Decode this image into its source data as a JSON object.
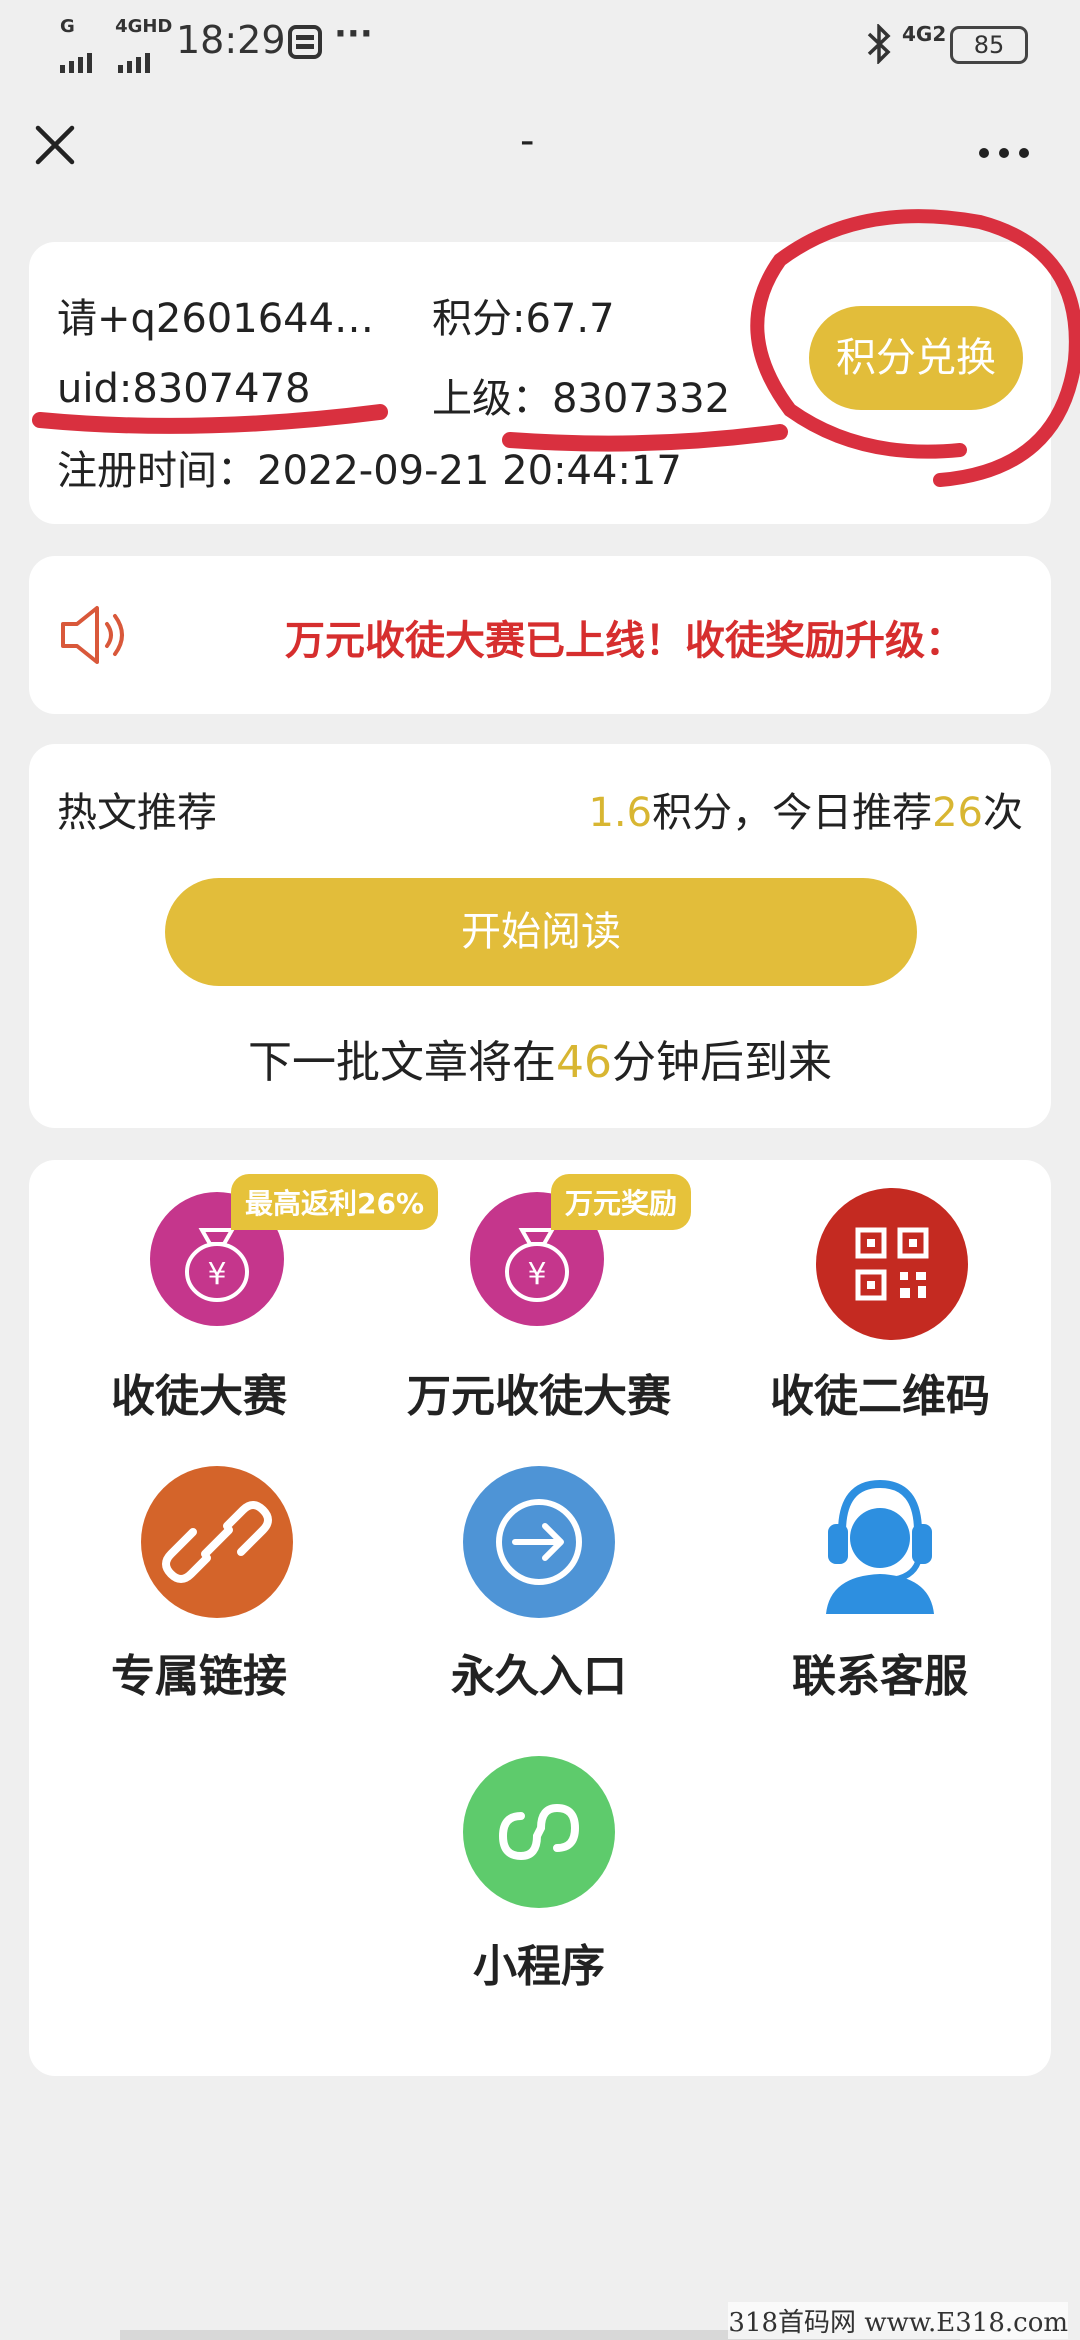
{
  "status_bar": {
    "signal_labels": [
      "G",
      "4GHD"
    ],
    "time": "18:29",
    "more": "···",
    "net": "4G2",
    "battery": "85"
  },
  "nav": {
    "title": "-",
    "more": "···"
  },
  "user": {
    "name": "请+q2601644…",
    "points": "积分:67.7",
    "uid": "uid:8307478",
    "superior": "上级：8307332",
    "register_time": "注册时间：2022-09-21 20:44:17",
    "exchange_button": "积分兑换"
  },
  "notice": {
    "text": "万元收徒大赛已上线！收徒奖励升级：",
    "icon": "speaker-icon"
  },
  "reading": {
    "title": "热文推荐",
    "points_value": "1.6",
    "points_text": "积分，今日推荐",
    "count": "26",
    "count_suffix": "次",
    "start_button": "开始阅读",
    "next_prefix": "下一批文章将在",
    "next_minutes": "46",
    "next_suffix": "分钟后到来"
  },
  "grid": [
    {
      "label": "收徒大赛",
      "badge": "最高返利26%",
      "icon": "money-bag-icon",
      "color": "#c5368c"
    },
    {
      "label": "万元收徒大赛",
      "badge": "万元奖励",
      "icon": "money-bag-icon",
      "color": "#c5368c"
    },
    {
      "label": "收徒二维码",
      "icon": "qr-code-icon",
      "color": "#c42a21"
    },
    {
      "label": "专属链接",
      "icon": "link-icon",
      "color": "#d4642a"
    },
    {
      "label": "永久入口",
      "icon": "enter-arrow-icon",
      "color": "#4e94d6"
    },
    {
      "label": "联系客服",
      "icon": "customer-service-icon",
      "color": "#2d8fe0"
    },
    {
      "label": "小程序",
      "icon": "mini-program-icon",
      "color": "#5ecb6c"
    }
  ],
  "watermark": "318首码网 www.E318.com"
}
